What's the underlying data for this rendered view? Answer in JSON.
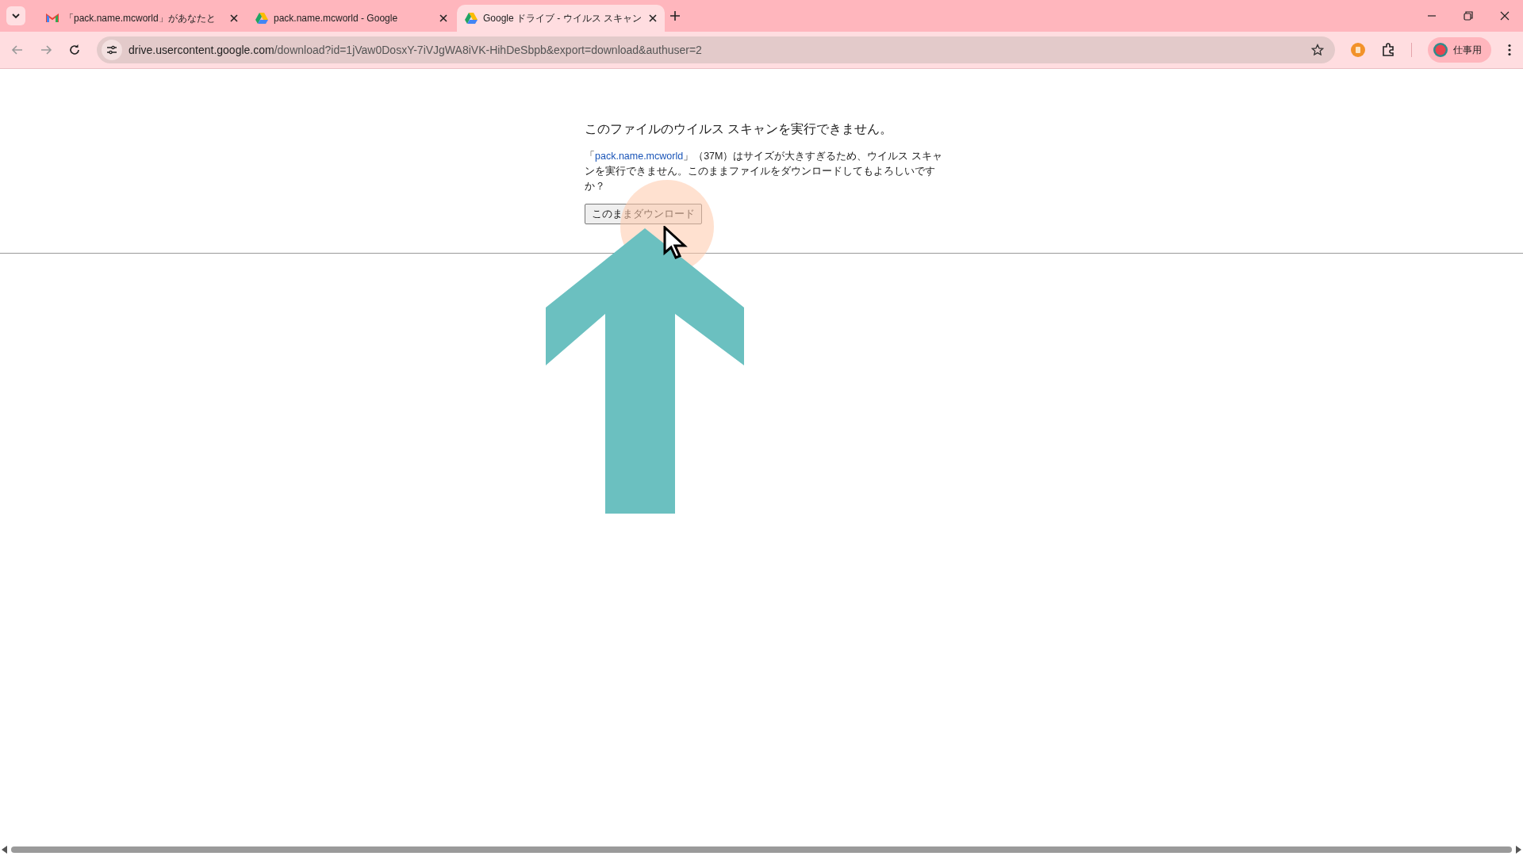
{
  "tabs": [
    {
      "title": "「pack.name.mcworld」があなたと",
      "kind": "mail",
      "selected": false
    },
    {
      "title": "pack.name.mcworld - Google",
      "kind": "drive",
      "selected": false
    },
    {
      "title": "Google ドライブ - ウイルス スキャン",
      "kind": "drive",
      "selected": true
    }
  ],
  "address_bar": {
    "host": "drive.usercontent.google.com",
    "path": "/download?id=1jVaw0DosxY-7iVJgWA8iVK-HihDeSbpb&export=download&authuser=2"
  },
  "profile": {
    "label": "仕事用"
  },
  "page": {
    "heading": "このファイルのウイルス スキャンを実行できません。",
    "message_before": "「",
    "file_link": "pack.name.mcworld",
    "message_after": "」（37M）はサイズが大きすぎるため、ウイルス スキャンを実行できません。このままファイルをダウンロードしてもよろしいですか？",
    "button": "このままダウンロード"
  }
}
